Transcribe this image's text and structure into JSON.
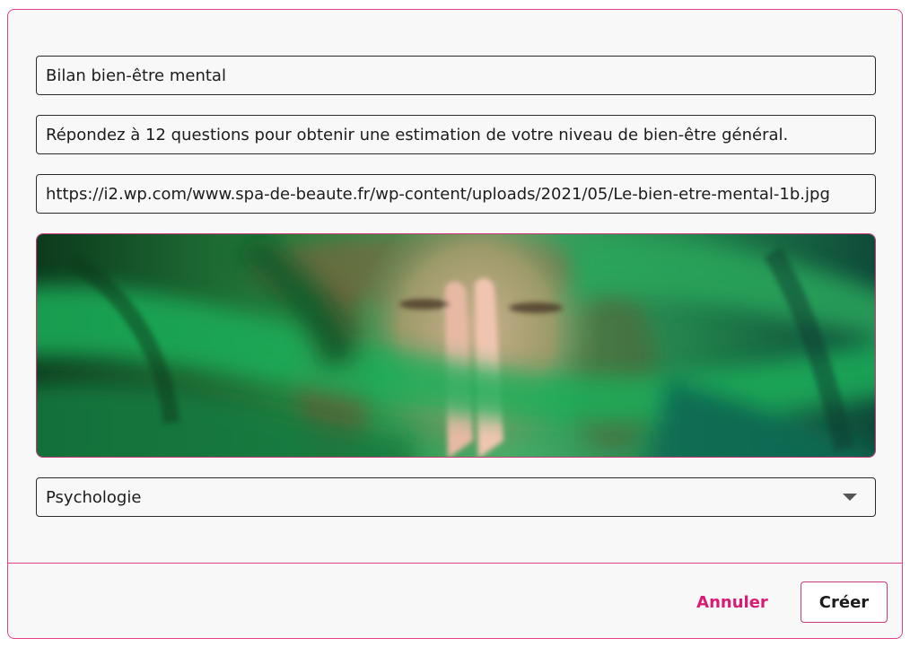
{
  "form": {
    "title_value": "Bilan bien-être mental",
    "description_value": "Répondez à 12 questions pour obtenir une estimation de votre niveau de bien-être général.",
    "image_url_value": "https://i2.wp.com/www.spa-de-beaute.fr/wp-content/uploads/2021/05/Le-bien-etre-mental-1b.jpg",
    "category_selected": "Psychologie"
  },
  "actions": {
    "cancel_label": "Annuler",
    "create_label": "Créer"
  },
  "icons": {
    "select_arrow": "chevron-down-icon"
  },
  "colors": {
    "accent": "#e4408a",
    "cancel_text": "#d81b74",
    "background": "#f8f8f8"
  }
}
